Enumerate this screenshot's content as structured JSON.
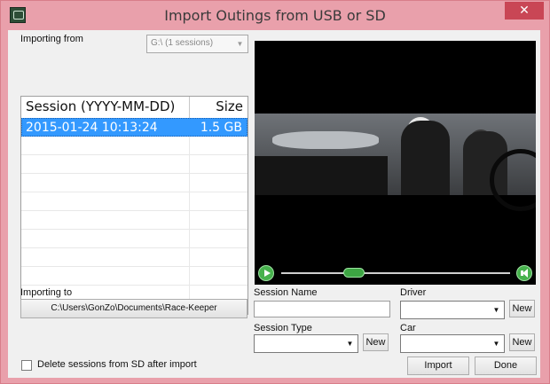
{
  "window": {
    "title": "Import Outings from USB or SD",
    "close_glyph": "✕"
  },
  "source": {
    "label": "Importing from",
    "selected": "G:\\ (1 sessions)"
  },
  "sessions": {
    "headers": {
      "name": "Session (YYYY-MM-DD)",
      "size": "Size"
    },
    "rows": [
      {
        "name": "2015-01-24 10:13:24",
        "size": "1.5 GB"
      }
    ]
  },
  "destination": {
    "label": "Importing to",
    "path": "C:\\Users\\GonZo\\Documents\\Race-Keeper"
  },
  "form": {
    "session_name_label": "Session Name",
    "session_name_value": "",
    "driver_label": "Driver",
    "driver_value": "",
    "session_type_label": "Session Type",
    "session_type_value": "",
    "car_label": "Car",
    "car_value": "",
    "new_label": "New"
  },
  "options": {
    "delete_after_import_label": "Delete sessions from SD after import",
    "delete_after_import_checked": false
  },
  "actions": {
    "import_label": "Import",
    "done_label": "Done"
  },
  "video": {
    "playback_fraction": 0.3
  },
  "icons": {
    "app": "race-keeper-app-icon",
    "play": "play-icon",
    "volume": "volume-icon",
    "dropdown": "chevron-down-icon"
  },
  "colors": {
    "titlebar": "#e9a0ab",
    "close": "#c94655",
    "selection": "#3399ff",
    "player_accent": "#47b24d"
  }
}
